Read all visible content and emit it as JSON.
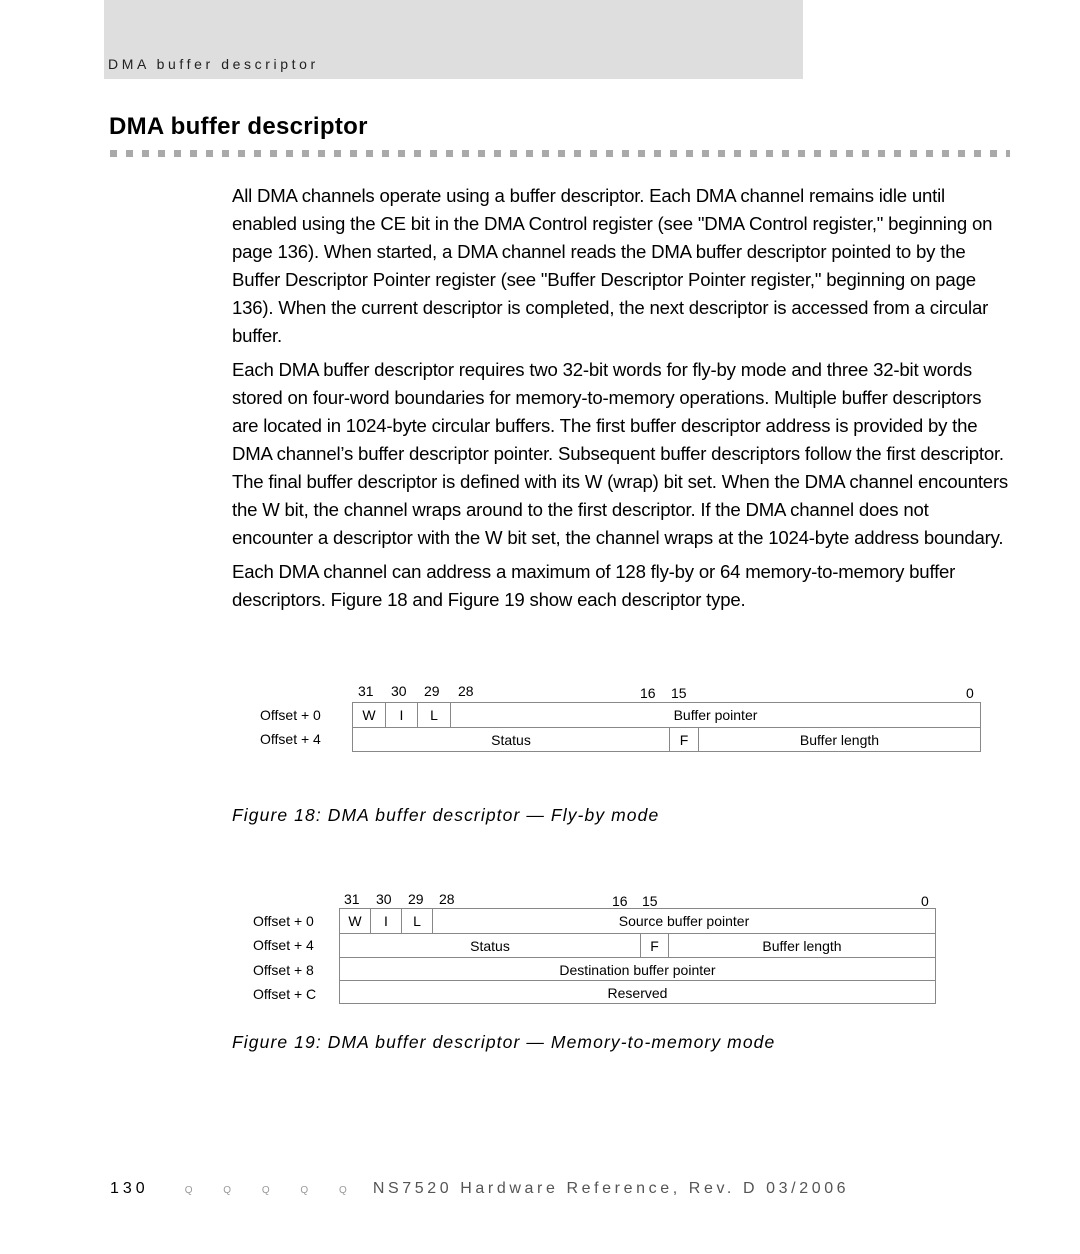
{
  "running_header": "DMA buffer descriptor",
  "title": "DMA buffer descriptor",
  "paragraphs": [
    "All DMA channels operate using a buffer descriptor. Each DMA channel remains idle until enabled using the CE bit in the DMA Control register (see \"DMA Control register,\" beginning on page 136). When started, a DMA channel reads the DMA buffer descriptor pointed to by the Buffer Descriptor Pointer register (see \"Buffer Descriptor Pointer register,\" beginning on page 136). When the current descriptor is completed, the next descriptor is accessed from a circular buffer.",
    "Each DMA buffer descriptor requires two 32-bit words for fly-by mode and three 32-bit words stored on four-word boundaries for memory-to-memory operations. Multiple buffer descriptors are located in 1024-byte circular buffers. The first buffer descriptor address is provided by the DMA channel’s buffer descriptor pointer. Subsequent buffer descriptors follow the first descriptor. The final buffer descriptor is defined with its W (wrap) bit set. When the DMA channel encounters the W bit, the channel wraps around to the first descriptor. If the DMA channel does not encounter a descriptor with the W bit set, the channel wraps at the 1024-byte address boundary.",
    "Each DMA channel can address a maximum of 128 fly-by or 64 memory-to-memory buffer descriptors. Figure 18 and Figure 19 show each descriptor type."
  ],
  "figure18": {
    "bits": [
      "31",
      "30",
      "29",
      "28",
      "16",
      "15",
      "0"
    ],
    "offsets": [
      "Offset +  0",
      "Offset +  4"
    ],
    "rows": [
      [
        "W",
        "I",
        "L",
        "Buffer pointer"
      ],
      [
        "Status",
        "F",
        "Buffer length"
      ]
    ],
    "caption": "Figure 18: DMA buffer descriptor — Fly-by mode"
  },
  "figure19": {
    "bits": [
      "31",
      "30",
      "29",
      "28",
      "16",
      "15",
      "0"
    ],
    "offsets": [
      "Offset +  0",
      "Offset +  4",
      "Offset +  8",
      "Offset +  C"
    ],
    "rows": [
      [
        "W",
        "I",
        "L",
        "Source buffer pointer"
      ],
      [
        "Status",
        "F",
        "Buffer length"
      ],
      [
        "Destination buffer pointer"
      ],
      [
        "Reserved"
      ]
    ],
    "caption": "Figure 19: DMA buffer descriptor — Memory-to-memory mode"
  },
  "footer": {
    "page_number": "130",
    "marks": "Q Q Q Q Q",
    "text": "NS7520 Hardware Reference, Rev. D  03/2006"
  }
}
